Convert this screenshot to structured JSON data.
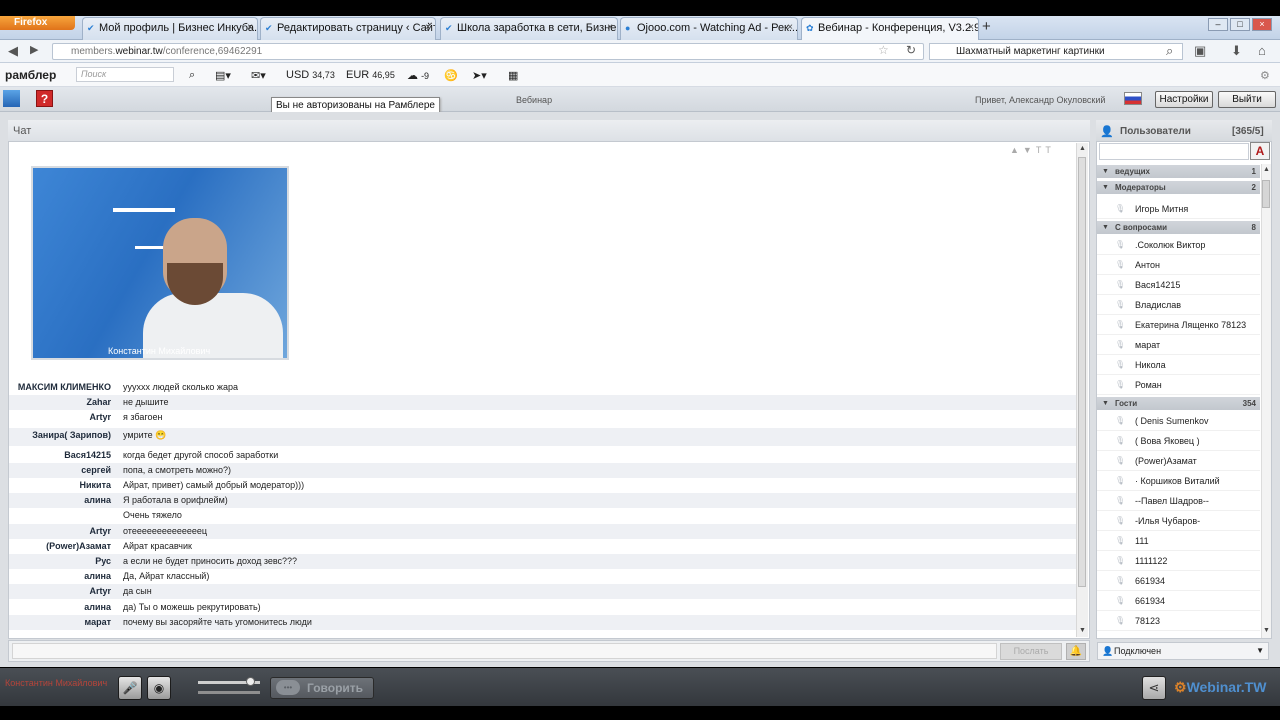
{
  "browser": {
    "app_button": "Firefox",
    "tabs": [
      {
        "label": "Мой профиль | Бизнес Инкуба..."
      },
      {
        "label": "Редактировать страницу ‹ Сайт ..."
      },
      {
        "label": "Школа заработка в сети, Бизне..."
      },
      {
        "label": "Ojooo.com - Watching Ad - Рек..."
      },
      {
        "label": "Вебинар - Конференция, V3.2.9..."
      }
    ],
    "url_prefix": "members.",
    "url_domain": "webinar.tw",
    "url_path": "/conference,69462291",
    "search_value": "Шахматный маркетинг картинки"
  },
  "rambler": {
    "logo": "рамблер",
    "search_placeholder": "Поиск",
    "usd_label": "USD",
    "usd_value": "34,73",
    "eur_label": "EUR",
    "eur_value": "46,95",
    "weather": "-9",
    "tooltip": "Вы не авторизованы на Рамблере"
  },
  "webinar": {
    "help": "?",
    "title": "Вебинар",
    "greeting": "Привет, Александр Окуловский",
    "settings_label": "Настройки",
    "exit_label": "Выйти"
  },
  "chat": {
    "title": "Чат",
    "video_name": "Константин Михайлович",
    "messages": [
      {
        "nick": "МАКСИМ КЛИМЕНКО",
        "text": "уууххх людей сколько жара"
      },
      {
        "nick": "Zahar",
        "text": "не дышите"
      },
      {
        "nick": "Artyr",
        "text": "я збагоен"
      },
      {
        "nick": "Занира( Зарипов)",
        "text": "умрите 😁"
      },
      {
        "nick": "Вася14215",
        "text": "когда бедет другой способ заработки"
      },
      {
        "nick": "сергей",
        "text": "попа, а смотреть можно?)"
      },
      {
        "nick": "Никита",
        "text": "Айрат, привет) самый добрый модератор)))"
      },
      {
        "nick": "алина",
        "text": "Я работала в орифлейм)"
      },
      {
        "nick": "",
        "text": "Очень тяжело"
      },
      {
        "nick": "Artyr",
        "text": "отеееееееееееееец"
      },
      {
        "nick": "(Power)Азамат",
        "text": "Айрат красавчик"
      },
      {
        "nick": "Рус",
        "text": "а если не будет приносить доход зевс???"
      },
      {
        "nick": "алина",
        "text": "Да, Айрат классный)"
      },
      {
        "nick": "Artyr",
        "text": "да сын"
      },
      {
        "nick": "алина",
        "text": "да) Ты о можешь рекрутировать)"
      },
      {
        "nick": "марат",
        "text": "почему вы засоряйте чать угомонитесь люди"
      }
    ],
    "send_label": "Послать"
  },
  "users": {
    "title": "Пользователи",
    "count": "[365/5]",
    "font_btn": "A",
    "groups": [
      {
        "name": "ведущих",
        "count": "1"
      },
      {
        "name": "Модераторы",
        "count": "2"
      },
      {
        "name": "С вопросами",
        "count": "8"
      },
      {
        "name": "Гости",
        "count": "354"
      }
    ],
    "moderators": [
      "Игорь Митня"
    ],
    "questions": [
      ".Соколюк Виктор",
      "Антон",
      "Вася14215",
      "Владислав",
      "Екатерина Лященко 78123",
      "марат",
      "Никола",
      "Роман"
    ],
    "guests": [
      "( Denis Sumenkov",
      "( Вова Яковец )",
      "(Power)Азамат",
      "· Коршиков Виталий",
      "--Павел Шадров--",
      "-Илья Чубаров-",
      "111",
      "1111122",
      "661934",
      "661934",
      "78123"
    ],
    "status": "Подключен"
  },
  "footer": {
    "presenter": "Константин Михайлович",
    "speak_label": "Говорить",
    "logo_main": "Webinar",
    "logo_suffix": ".TW"
  }
}
